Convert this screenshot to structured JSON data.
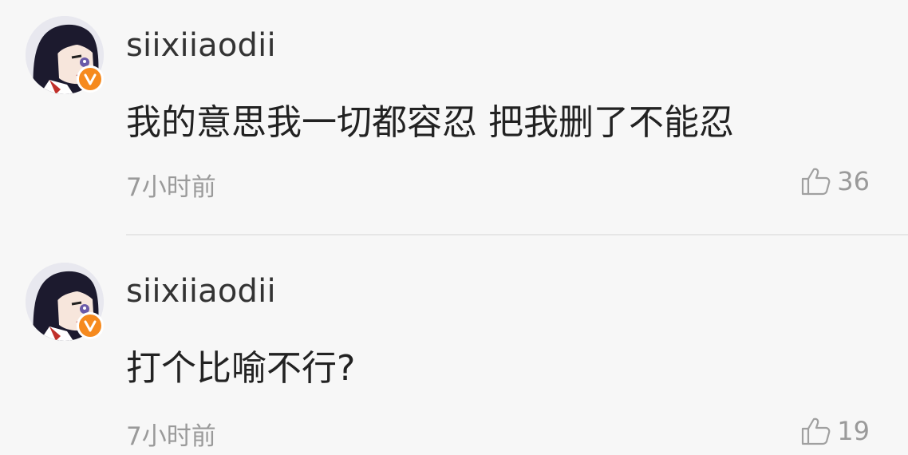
{
  "comments": [
    {
      "username": "siixiiaodii",
      "avatar_icon": "anime-girl-avatar",
      "badge_icon": "verified-v-badge",
      "badge_color": "#f68a1e",
      "text": "我的意思我一切都容忍 把我删了不能忍",
      "time": "7小时前",
      "likes": "36"
    },
    {
      "username": "siixiiaodii",
      "avatar_icon": "anime-girl-avatar",
      "badge_icon": "verified-v-badge",
      "badge_color": "#f68a1e",
      "text": "打个比喻不行?",
      "time": "7小时前",
      "likes": "19"
    }
  ]
}
